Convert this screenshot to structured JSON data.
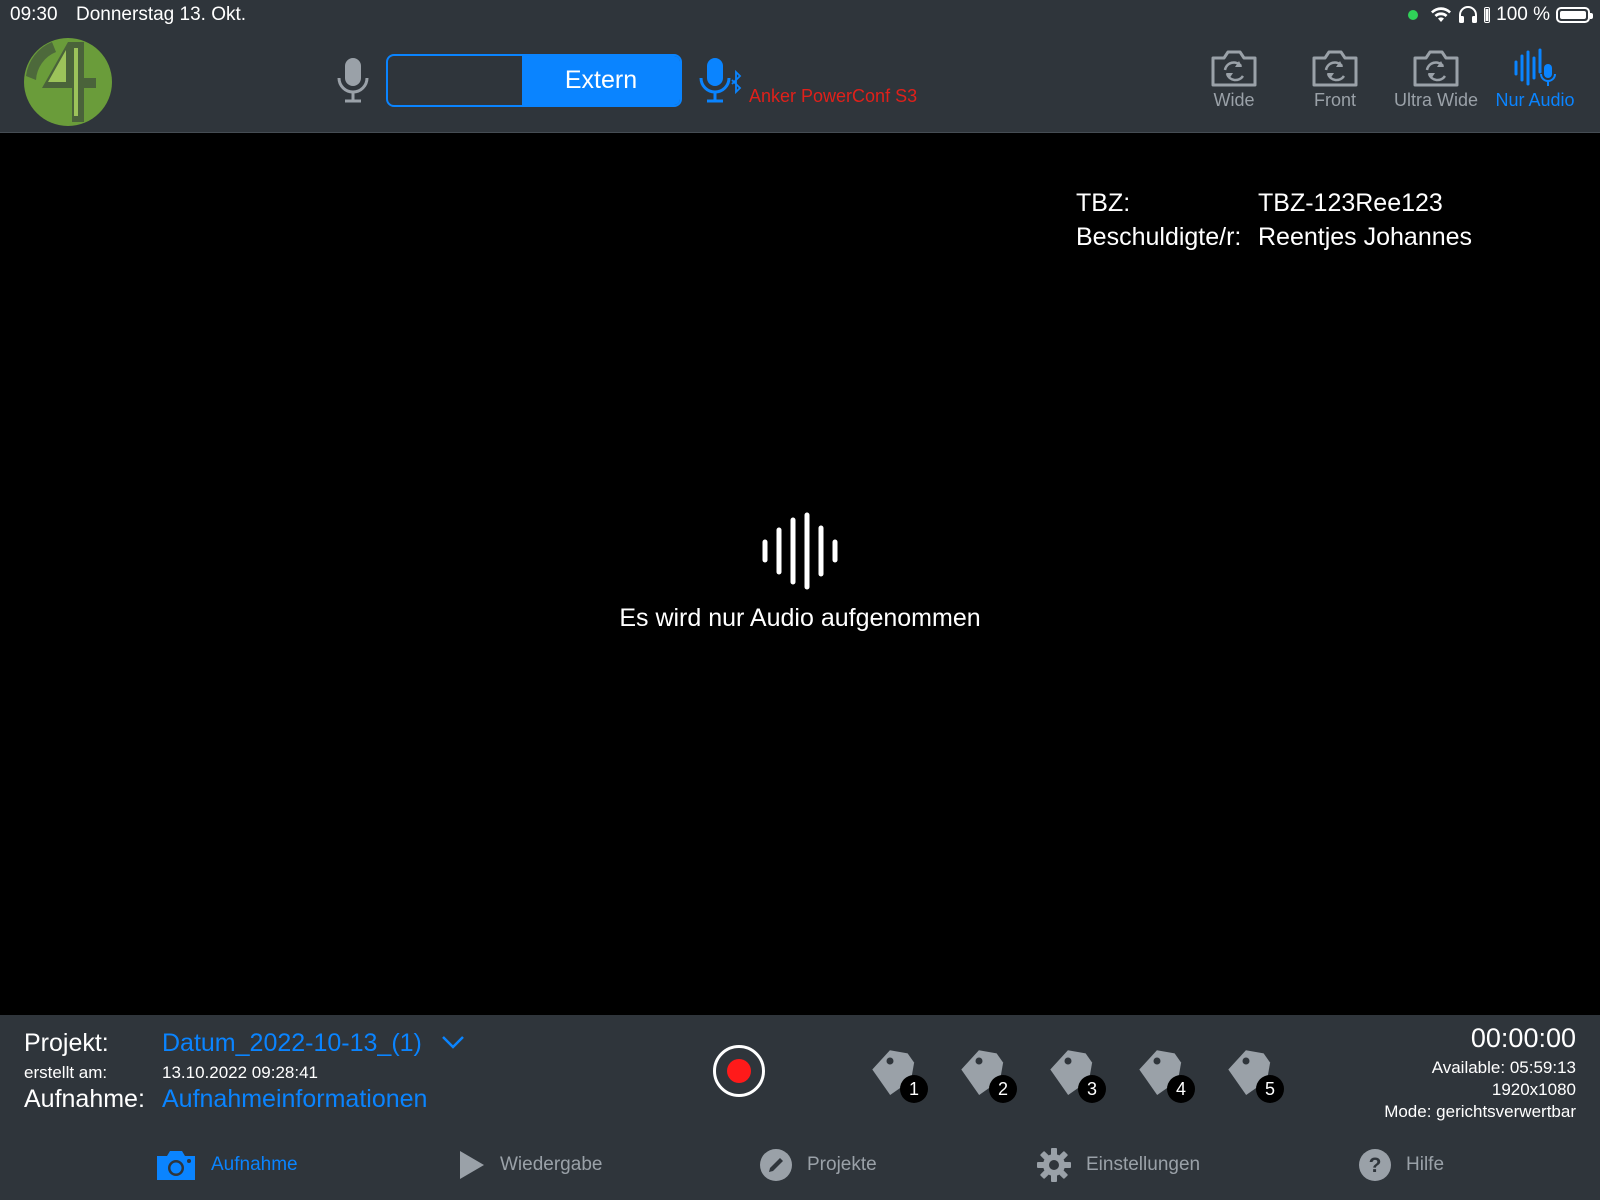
{
  "status_bar": {
    "time": "09:30",
    "date": "Donnerstag 13. Okt.",
    "battery": "100 %"
  },
  "toolbar": {
    "source_selected": "Extern",
    "external_device": "Anker PowerConf S3",
    "cameras": [
      {
        "label": "Wide",
        "icon": "camera-rotate-icon",
        "active": false
      },
      {
        "label": "Front",
        "icon": "camera-rotate-icon",
        "active": false
      },
      {
        "label": "Ultra Wide",
        "icon": "camera-rotate-icon",
        "active": false
      },
      {
        "label": "Nur Audio",
        "icon": "audio-wave-icon",
        "active": true
      }
    ]
  },
  "case_info": {
    "tbz_label": "TBZ:",
    "tbz_value": "TBZ-123Ree123",
    "accused_label": "Beschuldigte/r:",
    "accused_value": "Reentjes Johannes"
  },
  "preview": {
    "message": "Es wird nur Audio aufgenommen"
  },
  "recording_bar": {
    "project_label": "Projekt:",
    "project_value": "Datum_2022-10-13_(1)",
    "created_label": "erstellt am:",
    "created_value": "13.10.2022 09:28:41",
    "recording_label": "Aufnahme:",
    "recording_value": "Aufnahmeinformationen",
    "tags": [
      "1",
      "2",
      "3",
      "4",
      "5"
    ],
    "timer": "00:00:00",
    "available": "Available: 05:59:13",
    "resolution": "1920x1080",
    "mode": "Mode: gerichtsverwertbar"
  },
  "tabs": [
    {
      "label": "Aufnahme",
      "icon": "camera-icon",
      "active": true
    },
    {
      "label": "Wiedergabe",
      "icon": "play-icon",
      "active": false
    },
    {
      "label": "Projekte",
      "icon": "pencil-icon",
      "active": false
    },
    {
      "label": "Einstellungen",
      "icon": "gear-icon",
      "active": false
    },
    {
      "label": "Hilfe",
      "icon": "help-icon",
      "active": false
    }
  ],
  "colors": {
    "accent": "#0a84ff",
    "bar_background": "#2f353b",
    "record_red": "#ff1a1a",
    "device_red": "#e0201a",
    "logo_green": "#6a9c3a",
    "inactive": "#9aa1a8"
  }
}
